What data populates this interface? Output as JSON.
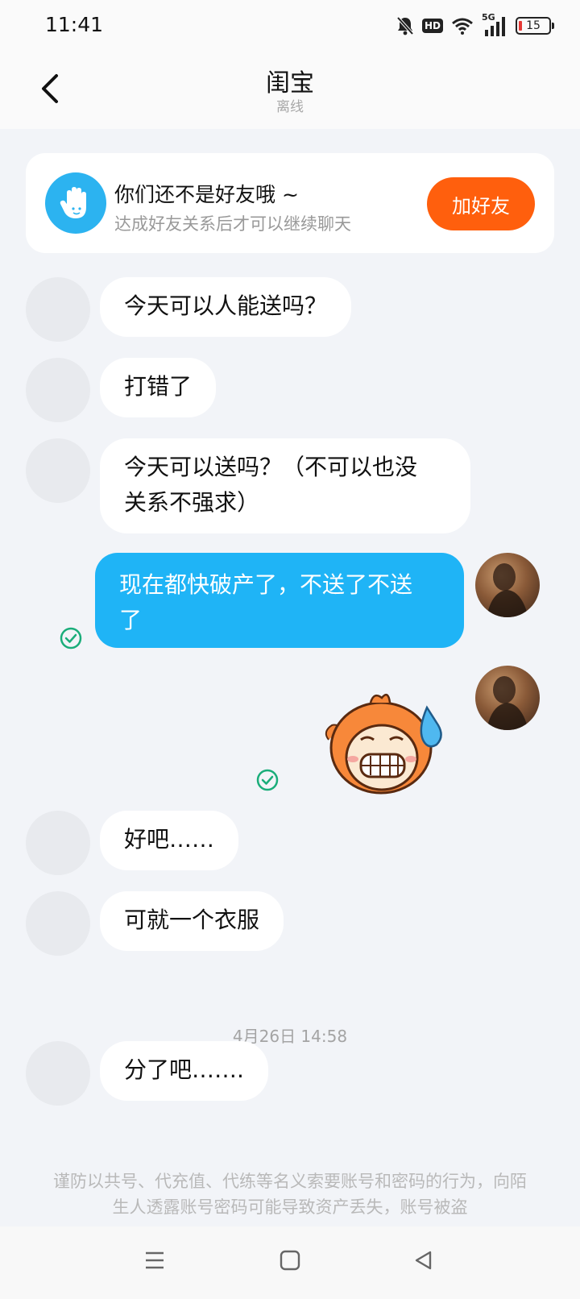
{
  "status_bar": {
    "time": "11:41",
    "hd": "HD",
    "network": "5G",
    "battery": "15",
    "icons": [
      "mute-bell-icon",
      "hd-icon",
      "wifi-icon",
      "signal-5g-icon",
      "battery-icon"
    ]
  },
  "header": {
    "title": "闺宝",
    "subtitle": "离线"
  },
  "friend_notice": {
    "title": "你们还不是好友哦 ~",
    "subtitle": "达成好友关系后才可以继续聊天",
    "button_label": "加好友",
    "button_color": "#ff5f0d"
  },
  "messages": [
    {
      "side": "in",
      "text": "今天可以人能送吗？"
    },
    {
      "side": "in",
      "text": "打错了"
    },
    {
      "side": "in",
      "text_line1": "今天可以送吗？（不可以也没",
      "text_line2": "关系不强求）"
    },
    {
      "side": "out",
      "text_line1": "现在都快破产了，不送了不送",
      "text_line2": "了",
      "status": "read"
    },
    {
      "side": "out",
      "type": "sticker",
      "sticker": "sweating-grimace-sticker",
      "status": "read"
    },
    {
      "side": "in",
      "text": "好吧……"
    },
    {
      "side": "in",
      "text": "可就一个衣服"
    },
    {
      "side": "in",
      "text": "分了吧……."
    }
  ],
  "timestamp": "4月26日 14:58",
  "warning": "谨防以共号、代充值、代练等名义索要账号和密码的行为，向陌生人透露账号密码可能导致资产丢失，账号被盗",
  "colors": {
    "background": "#f2f4f8",
    "outgoing_bubble": "#1fb4f6",
    "incoming_bubble": "#ffffff",
    "read_check": "#1aad7a"
  }
}
